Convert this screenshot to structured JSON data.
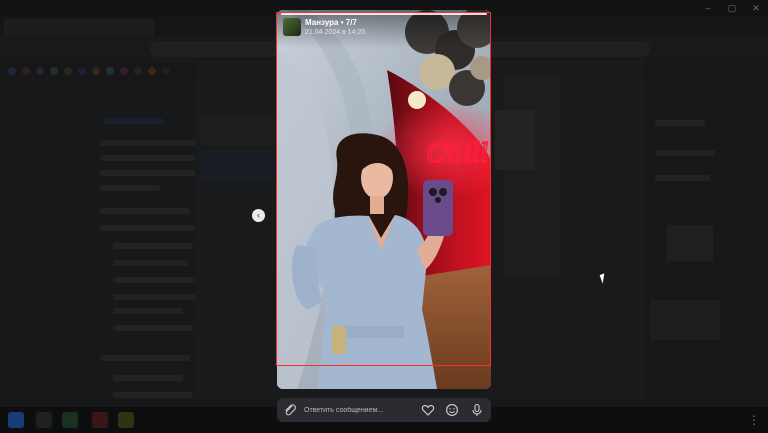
{
  "viewer": {
    "author": "Манзура • 7/7",
    "date": "21.04.2024 в 14:20",
    "neon_sign": "Chill",
    "reply_placeholder": "Ответить сообщением..."
  },
  "icons": {
    "attach": "paperclip-icon",
    "like": "heart-icon",
    "emoji": "smile-icon",
    "voice": "microphone-icon",
    "prev": "chevron-left-icon"
  },
  "colors": {
    "highlight_frame": "#ff2a2a",
    "neon": "#ff1e3c",
    "reply_bar": "#2a2c31"
  }
}
